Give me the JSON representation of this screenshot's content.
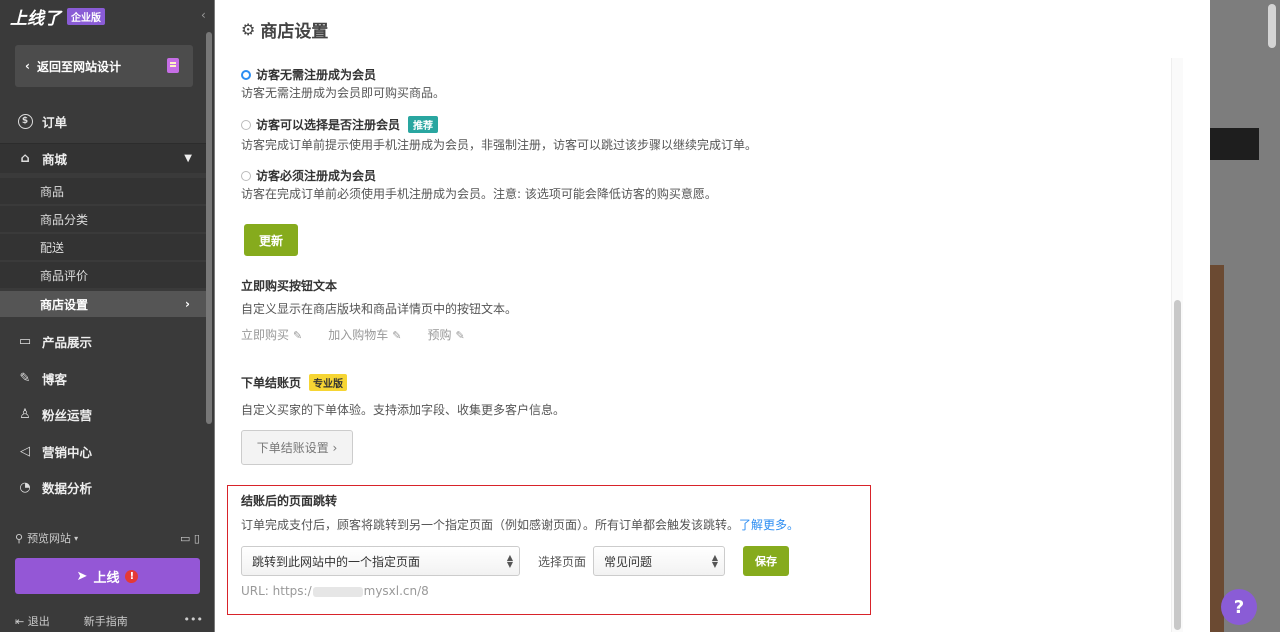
{
  "sidebar": {
    "brand_logo": "上线了",
    "brand_badge": "企业版",
    "back_label": "返回至网站设计",
    "nav": {
      "orders": "订单",
      "mall": "商城",
      "products_show": "产品展示",
      "blog": "博客",
      "fans": "粉丝运营",
      "marketing": "营销中心",
      "analytics": "数据分析"
    },
    "mall_sub": [
      "商品",
      "商品分类",
      "配送",
      "商品评价",
      "商店设置"
    ],
    "preview": "预览网站",
    "publish": "上线",
    "logout": "退出",
    "guide": "新手指南",
    "more": "•••"
  },
  "panel": {
    "title": "商店设置",
    "options": [
      {
        "title": "访客无需注册成为会员",
        "desc": "访客无需注册成为会员即可购买商品。",
        "selected": true
      },
      {
        "title": "访客可以选择是否注册会员",
        "tag": "推荐",
        "desc": "访客完成订单前提示使用手机注册成为会员，非强制注册，访客可以跳过该步骤以继续完成订单。",
        "selected": false
      },
      {
        "title": "访客必须注册成为会员",
        "desc": "访客在完成订单前必须使用手机注册成为会员。注意: 该选项可能会降低访客的购买意愿。",
        "selected": false
      }
    ],
    "update_label": "更新",
    "buy_now": {
      "title": "立即购买按钮文本",
      "desc": "自定义显示在商店版块和商品详情页中的按钮文本。",
      "items": [
        "立即购买",
        "加入购物车",
        "预购"
      ]
    },
    "checkout": {
      "title": "下单结账页",
      "tag": "专业版",
      "desc": "自定义买家的下单体验。支持添加字段、收集更多客户信息。",
      "button": "下单结账设置 ›"
    },
    "redirect": {
      "title": "结账后的页面跳转",
      "desc": "订单完成支付后，顾客将跳转到另一个指定页面（例如感谢页面）。所有订单都会触发该跳转。",
      "link": "了解更多。",
      "select_value": "跳转到此网站中的一个指定页面",
      "page_label": "选择页面",
      "page_value": "常见问题",
      "save_label": "保存",
      "url_prefix": "URL: https:/",
      "url_suffix": "mysxl.cn/8"
    }
  },
  "help": "?",
  "colors": {
    "sidebar_bg": "#3a3a3a",
    "accent_purple": "#9457d6",
    "green_button": "#86ab1d",
    "link_blue": "#2c8df2",
    "highlight_red": "#d8232a"
  }
}
